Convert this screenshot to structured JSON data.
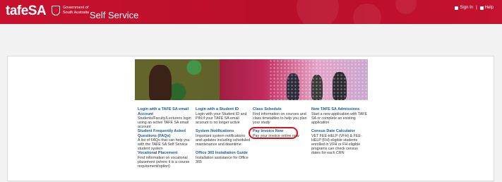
{
  "header": {
    "logo": "tafeSA",
    "gov_text": "Government of South Australia",
    "app_title": "Self Service",
    "sign_in": "Sign In",
    "separator": "|",
    "help": "Help"
  },
  "links": [
    {
      "title": "Login with a TAFE SA email Account",
      "desc": "Students/Faculty/Lecturers login using an active TAFE SA email account"
    },
    {
      "title": "Login with a Student ID",
      "desc": "Login with your Student ID and PIN if your TAFE SA email account is no longer active"
    },
    {
      "title": "Class Schedule",
      "desc": "Find information on courses and class timetables to help you plan your study"
    },
    {
      "title": "New TAFE SA Admissions",
      "desc": "Start a new application with TAFE SA or complete an existing application"
    },
    {
      "title": "Student Frequently Asked Questions (FAQs)",
      "desc": "A list of FAQs that can help you with the TAFE SA Self Service student system"
    },
    {
      "title": "System Notifications",
      "desc": "Important system notifications and updates including scheduled maintenance and downtime"
    },
    {
      "title": "Pay Invoice Now",
      "desc": "Pay your invoice online now"
    },
    {
      "title": "Census Date Calculator",
      "desc": "VET FEE-HELP (VFH) & FEE-HELP (FH) eligible students enrolled in VFH or FH eligible programs can check census dates for each CRN"
    },
    {
      "title": "Vocational Placement",
      "desc": "Find information on vocational placement (where it is a course requirement/option)"
    },
    {
      "title": "Office 365 Installation Guide",
      "desc": "Installation assistance for Office 365"
    }
  ],
  "colors": {
    "brand_red": "#c8102e",
    "link_blue": "#1a5a9c",
    "highlight_red": "#d4141e"
  }
}
